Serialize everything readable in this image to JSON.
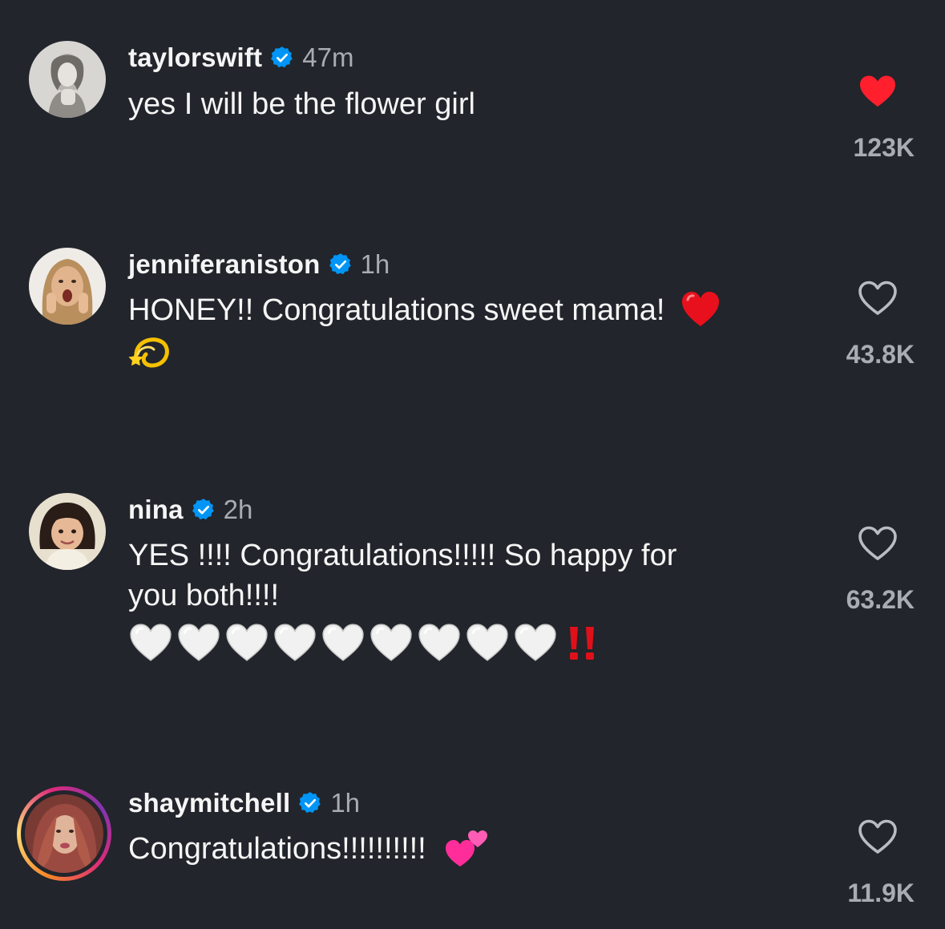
{
  "comments": [
    {
      "username": "taylorswift",
      "time": "47m",
      "text": "yes I will be the flower girl",
      "likes": "123K",
      "liked": true
    },
    {
      "username": "jenniferaniston",
      "time": "1h",
      "text": "HONEY!! Congratulations sweet mama!",
      "likes": "43.8K",
      "liked": false
    },
    {
      "username": "nina",
      "time": "2h",
      "text_line1": "YES !!!! Congratulations!!!!! So happy for",
      "text_line2": "you both!!!!",
      "likes": "63.2K",
      "liked": false
    },
    {
      "username": "shaymitchell",
      "time": "1h",
      "text": "Congratulations!!!!!!!!!!",
      "likes": "11.9K",
      "liked": false
    }
  ],
  "colors": {
    "background": "#22252b",
    "verified": "#0095f6",
    "liked_heart": "#ff1f2d",
    "meta_gray": "#a8acb3"
  },
  "icons": {
    "verified": "verified-badge-icon",
    "like_filled": "heart-filled-icon",
    "like_outline": "heart-outline-icon"
  }
}
